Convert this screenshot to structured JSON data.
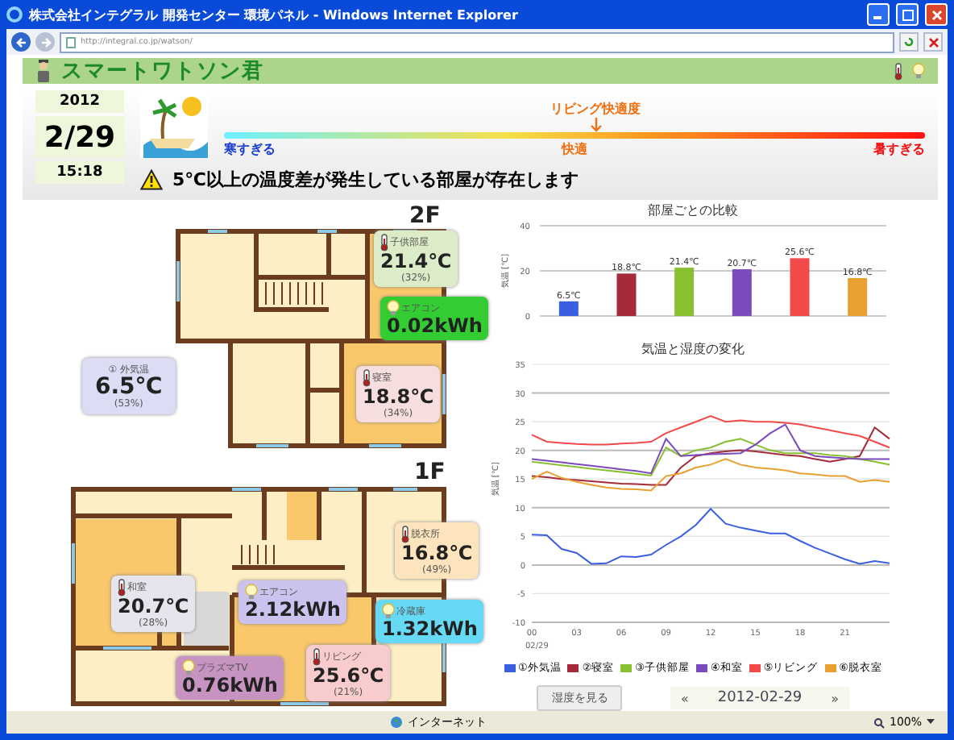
{
  "window": {
    "title": "株式会社インテグラル 開発センター 環境パネル - Windows Internet Explorer"
  },
  "address_bar": {
    "url": "http://integral.co.jp/watson/"
  },
  "header": {
    "logo": "スマートワトソン君"
  },
  "date": {
    "year": "2012",
    "day": "2/29",
    "time": "15:18"
  },
  "comfort": {
    "label": "リビング快適度",
    "level": 0.53,
    "scale_labels": [
      "寒すぎる",
      "快適",
      "暑すぎる"
    ]
  },
  "alert": {
    "message": "5℃以上の温度差が発生している部屋が存在します"
  },
  "outside": {
    "label": "① 外気温",
    "value": "6.5℃",
    "humidity": "(53%)",
    "color": "#dcdcf5"
  },
  "floors": [
    {
      "label": "2F",
      "sensors": [
        {
          "kind": "temperature",
          "room": "子供部屋",
          "value": "21.4℃",
          "humidity": "(32%)",
          "color": "#dcebc8"
        },
        {
          "kind": "power",
          "device": "エアコン",
          "value": "0.02kWh",
          "color": "#33cc33"
        },
        {
          "kind": "temperature",
          "room": "寝室",
          "value": "18.8℃",
          "humidity": "(34%)",
          "color": "#f6dede"
        }
      ]
    },
    {
      "label": "1F",
      "sensors": [
        {
          "kind": "temperature",
          "room": "和室",
          "value": "20.7℃",
          "humidity": "(28%)",
          "color": "#e6e4ec"
        },
        {
          "kind": "power",
          "device": "エアコン",
          "value": "2.12kWh",
          "color": "#cbc3ee"
        },
        {
          "kind": "temperature",
          "room": "脱衣所",
          "value": "16.8℃",
          "humidity": "(49%)",
          "color": "#fde4bc"
        },
        {
          "kind": "power",
          "device": "冷蔵庫",
          "value": "1.32kWh",
          "color": "#66d9f5"
        },
        {
          "kind": "power",
          "device": "プラズマTV",
          "value": "0.76kWh",
          "color": "#c794c2"
        },
        {
          "kind": "temperature",
          "room": "リビング",
          "value": "25.6℃",
          "humidity": "(21%)",
          "color": "#f8cccc"
        }
      ]
    }
  ],
  "bar_chart": {
    "chart_data": {
      "type": "bar",
      "title": "部屋ごとの比較",
      "ylabel": "気温 [℃]",
      "ylim": [
        0,
        40
      ],
      "yticks": [
        0,
        20,
        40
      ],
      "values": [
        6.5,
        18.8,
        21.4,
        20.7,
        25.6,
        16.8
      ],
      "value_labels": [
        "6.5℃",
        "18.8℃",
        "21.4℃",
        "20.7℃",
        "25.6℃",
        "16.8℃"
      ]
    }
  },
  "line_chart": {
    "chart_data": {
      "type": "line",
      "title": "気温と湿度の変化",
      "ylabel": "気温 [℃]",
      "xlabel": "02/29",
      "grid": true,
      "xlim": [
        0,
        24
      ],
      "ylim": [
        -10,
        35
      ],
      "xticks": [
        {
          "value": 0,
          "label": "00"
        },
        {
          "value": 3,
          "label": "03"
        },
        {
          "value": 6,
          "label": "06"
        },
        {
          "value": 9,
          "label": "09"
        },
        {
          "value": 12,
          "label": "12"
        },
        {
          "value": 15,
          "label": "15"
        },
        {
          "value": 18,
          "label": "18"
        },
        {
          "value": 21,
          "label": "21"
        }
      ],
      "yticks": [
        -10,
        -5,
        0,
        5,
        10,
        15,
        20,
        25,
        30,
        35
      ],
      "x": [
        0,
        1,
        2,
        3,
        4,
        5,
        6,
        7,
        8,
        9,
        10,
        11,
        12,
        13,
        14,
        15,
        16,
        17,
        18,
        19,
        20,
        21,
        22,
        23,
        24
      ],
      "series": [
        {
          "name": "①外気温",
          "color": "#3a5fe0",
          "values": [
            5.3,
            5.2,
            2.8,
            2.1,
            0.2,
            0.3,
            1.5,
            1.4,
            1.8,
            3.5,
            5,
            7,
            9.8,
            7.2,
            6.5,
            6,
            5.5,
            5.5,
            4.2,
            3,
            2,
            1,
            0.2,
            0.7,
            0.3
          ]
        },
        {
          "name": "②寝室",
          "color": "#a52a3a",
          "values": [
            15.5,
            15.3,
            15,
            14.8,
            14.6,
            14.4,
            14.2,
            14.1,
            14,
            14,
            17,
            19,
            19.5,
            19.8,
            20,
            19.8,
            19.5,
            19.2,
            19,
            18.5,
            18,
            18.5,
            19,
            24,
            22
          ]
        },
        {
          "name": "③子供部屋",
          "color": "#88c030",
          "values": [
            18,
            17.7,
            17.4,
            17.1,
            16.8,
            16.5,
            16.2,
            15.9,
            15.6,
            20.5,
            19,
            20,
            20.5,
            21.5,
            22,
            21,
            20,
            19.5,
            19.5,
            19.5,
            19.2,
            19,
            18.5,
            18,
            17.5
          ]
        },
        {
          "name": "④和室",
          "color": "#7b4bbd",
          "values": [
            18.5,
            18.2,
            17.9,
            17.6,
            17.3,
            17,
            16.7,
            16.4,
            16,
            22,
            19,
            19.2,
            19.3,
            19.4,
            19.5,
            21,
            23,
            24.5,
            20,
            19,
            18.8,
            18.6,
            18.5,
            18.5,
            18.5
          ]
        },
        {
          "name": "⑤リビング",
          "color": "#f24a48",
          "values": [
            22.7,
            21.5,
            21.3,
            21.1,
            21,
            21,
            21.2,
            21.3,
            21.5,
            23,
            24,
            25,
            26,
            25,
            25.2,
            25,
            25,
            24.8,
            24.5,
            24,
            23.5,
            23,
            22.5,
            21.5,
            20.5
          ]
        },
        {
          "name": "⑥脱衣室",
          "color": "#e8a030",
          "values": [
            15,
            16.3,
            15.2,
            14.5,
            14,
            13.5,
            13.3,
            13.2,
            13,
            15.5,
            16,
            17,
            17.5,
            18.5,
            17.5,
            17,
            16.8,
            16.5,
            16,
            15.8,
            15.5,
            15.5,
            14.5,
            14.8,
            14.5
          ]
        }
      ]
    }
  },
  "controls": {
    "humidity_button": "湿度を見る",
    "prev": "«",
    "date": "2012-02-29",
    "next": "»"
  },
  "status_bar": {
    "zone": "インターネット",
    "zoom": "100%"
  }
}
